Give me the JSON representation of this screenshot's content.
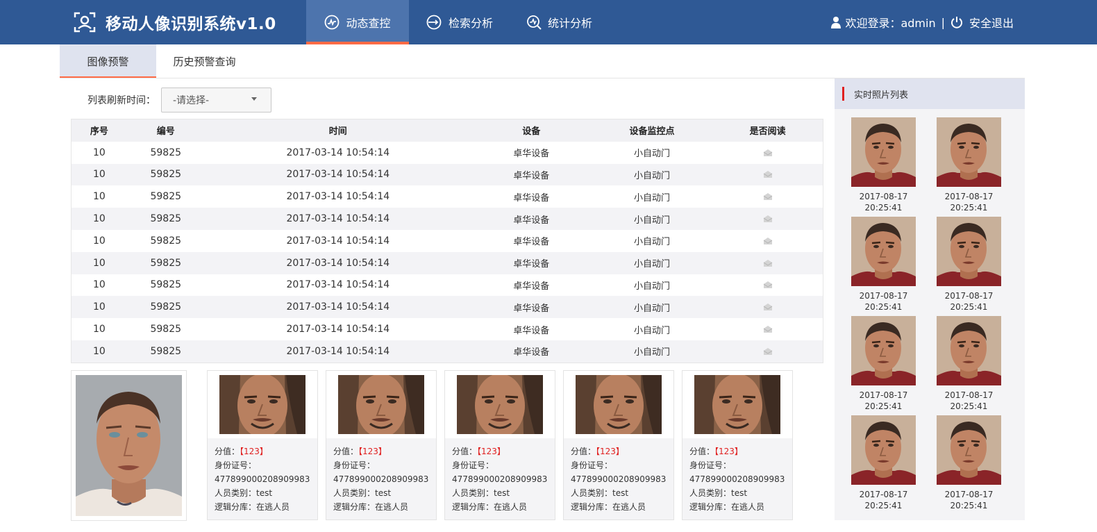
{
  "header": {
    "title": "移动人像识别系统v1.0",
    "nav": [
      {
        "label": "动态查控",
        "icon": "pulse-icon",
        "active": true
      },
      {
        "label": "检索分析",
        "icon": "retrieve-icon",
        "active": false
      },
      {
        "label": "统计分析",
        "icon": "stats-icon",
        "active": false
      }
    ],
    "welcome": "欢迎登录：admin",
    "separator": "|",
    "logout": "安全退出"
  },
  "subtabs": [
    {
      "label": "图像预警",
      "active": true
    },
    {
      "label": "历史预警查询",
      "active": false
    }
  ],
  "filter": {
    "label": "列表刷新时间：",
    "select_value": "-请选择-"
  },
  "table": {
    "headers": [
      "序号",
      "编号",
      "时间",
      "设备",
      "设备监控点",
      "是否阅读"
    ],
    "rows": [
      {
        "seq": "10",
        "id": "59825",
        "time": "2017-03-14 10:54:14",
        "device": "卓华设备",
        "point": "小自动门",
        "read": "mail-icon"
      },
      {
        "seq": "10",
        "id": "59825",
        "time": "2017-03-14 10:54:14",
        "device": "卓华设备",
        "point": "小自动门",
        "read": "mail-icon"
      },
      {
        "seq": "10",
        "id": "59825",
        "time": "2017-03-14 10:54:14",
        "device": "卓华设备",
        "point": "小自动门",
        "read": "mail-icon"
      },
      {
        "seq": "10",
        "id": "59825",
        "time": "2017-03-14 10:54:14",
        "device": "卓华设备",
        "point": "小自动门",
        "read": "mail-icon"
      },
      {
        "seq": "10",
        "id": "59825",
        "time": "2017-03-14 10:54:14",
        "device": "卓华设备",
        "point": "小自动门",
        "read": "mail-icon"
      },
      {
        "seq": "10",
        "id": "59825",
        "time": "2017-03-14 10:54:14",
        "device": "卓华设备",
        "point": "小自动门",
        "read": "mail-icon"
      },
      {
        "seq": "10",
        "id": "59825",
        "time": "2017-03-14 10:54:14",
        "device": "卓华设备",
        "point": "小自动门",
        "read": "mail-icon"
      },
      {
        "seq": "10",
        "id": "59825",
        "time": "2017-03-14 10:54:14",
        "device": "卓华设备",
        "point": "小自动门",
        "read": "mail-icon"
      },
      {
        "seq": "10",
        "id": "59825",
        "time": "2017-03-14 10:54:14",
        "device": "卓华设备",
        "point": "小自动门",
        "read": "mail-icon"
      },
      {
        "seq": "10",
        "id": "59825",
        "time": "2017-03-14 10:54:14",
        "device": "卓华设备",
        "point": "小自动门",
        "read": "mail-icon"
      }
    ]
  },
  "match_cards": [
    {
      "score_label": "分值：",
      "score": "【123】",
      "id_label": "身份证号：",
      "id_number": "477899000208909983",
      "category": "人员类别：test",
      "library": "逻辑分库：在逃人员"
    },
    {
      "score_label": "分值：",
      "score": "【123】",
      "id_label": "身份证号：",
      "id_number": "477899000208909983",
      "category": "人员类别：test",
      "library": "逻辑分库：在逃人员"
    },
    {
      "score_label": "分值：",
      "score": "【123】",
      "id_label": "身份证号：",
      "id_number": "477899000208909983",
      "category": "人员类别：test",
      "library": "逻辑分库：在逃人员"
    },
    {
      "score_label": "分值：",
      "score": "【123】",
      "id_label": "身份证号：",
      "id_number": "477899000208909983",
      "category": "人员类别：test",
      "library": "逻辑分库：在逃人员"
    },
    {
      "score_label": "分值：",
      "score": "【123】",
      "id_label": "身份证号：",
      "id_number": "477899000208909983",
      "category": "人员类别：test",
      "library": "逻辑分库：在逃人员"
    }
  ],
  "realtime": {
    "title": "实时照片列表",
    "photos": [
      {
        "date": "2017-08-17",
        "time": "20:25:41"
      },
      {
        "date": "2017-08-17",
        "time": "20:25:41"
      },
      {
        "date": "2017-08-17",
        "time": "20:25:41"
      },
      {
        "date": "2017-08-17",
        "time": "20:25:41"
      },
      {
        "date": "2017-08-17",
        "time": "20:25:41"
      },
      {
        "date": "2017-08-17",
        "time": "20:25:41"
      },
      {
        "date": "2017-08-17",
        "time": "20:25:41"
      },
      {
        "date": "2017-08-17",
        "time": "20:25:41"
      }
    ]
  },
  "colors": {
    "header_bg": "#2f5995",
    "active_nav_bg": "#4d74ad",
    "accent": "#ff6b45",
    "score_red": "#e02020"
  }
}
